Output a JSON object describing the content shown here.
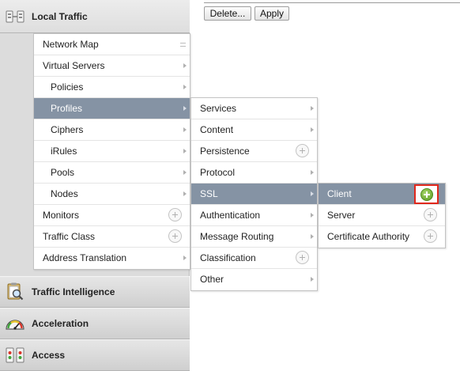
{
  "buttons": {
    "delete": "Delete...",
    "apply": "Apply"
  },
  "sections": {
    "local_traffic": "Local Traffic",
    "traffic_intelligence": "Traffic Intelligence",
    "acceleration": "Acceleration",
    "access": "Access"
  },
  "menu_local_traffic": [
    "Network Map",
    "Virtual Servers",
    "Policies",
    "Profiles",
    "Ciphers",
    "iRules",
    "Pools",
    "Nodes",
    "Monitors",
    "Traffic Class",
    "Address Translation"
  ],
  "menu_profiles": [
    "Services",
    "Content",
    "Persistence",
    "Protocol",
    "SSL",
    "Authentication",
    "Message Routing",
    "Classification",
    "Other"
  ],
  "menu_ssl": [
    "Client",
    "Server",
    "Certificate Authority"
  ],
  "colors": {
    "active_row": "#8593a4",
    "highlight_border": "#e0281c",
    "add_icon_green": "#5c9a22"
  }
}
